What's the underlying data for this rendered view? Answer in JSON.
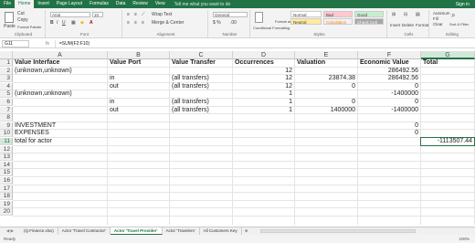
{
  "ribbon_tabs": [
    "File",
    "Home",
    "Insert",
    "Page Layout",
    "Formulas",
    "Data",
    "Review",
    "View"
  ],
  "active_tab_index": 1,
  "tell_me": "Tell me what you want to do",
  "user": "Sign in",
  "ribbon": {
    "clipboard": {
      "paste": "Paste",
      "cut": "Cut",
      "copy": "Copy",
      "format_painter": "Format Painter",
      "label": "Clipboard"
    },
    "font": {
      "name": "Arial",
      "size": "10",
      "label": "Font"
    },
    "alignment": {
      "wrap": "Wrap Text",
      "merge": "Merge & Center",
      "label": "Alignment"
    },
    "number": {
      "format": "General",
      "label": "Number"
    },
    "styles": {
      "conditional": "Conditional Formatting",
      "table": "Format as Table",
      "normal": "Normal",
      "bad": "Bad",
      "good": "Good",
      "neutral": "Neutral",
      "calculation": "Calculation",
      "check_cell": "Check Cell",
      "label": "Styles"
    },
    "cells": {
      "insert": "Insert",
      "delete": "Delete",
      "format": "Format",
      "label": "Cells"
    },
    "editing": {
      "autosum": "AutoSum",
      "fill": "Fill",
      "clear": "Clear",
      "sort": "Sort & Filter",
      "find": "Find & Select",
      "label": "Editing"
    }
  },
  "formula_bar": {
    "name_box": "G11",
    "fx": "fx",
    "value": "=SUM(F2:F10)"
  },
  "columns": [
    "A",
    "B",
    "C",
    "D",
    "E",
    "F",
    "G"
  ],
  "selected_column": "G",
  "rows": [
    {
      "n": "1",
      "A": "Value Interface",
      "B": "Value Port",
      "C": "Value Transfer",
      "D": "Occurrences",
      "E": "Valuation",
      "F": "Economic Value",
      "G": "Total"
    },
    {
      "n": "2",
      "A": "(unknown,unknown)",
      "B": "",
      "C": "",
      "D": "12",
      "E": "",
      "F": "286492.56",
      "G": ""
    },
    {
      "n": "3",
      "A": "",
      "B": "in",
      "C": "(all transfers)",
      "D": "12",
      "E": "23874.38",
      "F": "286492.56",
      "G": ""
    },
    {
      "n": "4",
      "A": "",
      "B": "out",
      "C": "(all transfers)",
      "D": "12",
      "E": "0",
      "F": "0",
      "G": ""
    },
    {
      "n": "5",
      "A": "(unknown,unknown)",
      "B": "",
      "C": "",
      "D": "1",
      "E": "",
      "F": "-1400000",
      "G": ""
    },
    {
      "n": "6",
      "A": "",
      "B": "in",
      "C": "(all transfers)",
      "D": "1",
      "E": "0",
      "F": "0",
      "G": ""
    },
    {
      "n": "7",
      "A": "",
      "B": "out",
      "C": "(all transfers)",
      "D": "1",
      "E": "1400000",
      "F": "-1400000",
      "G": ""
    },
    {
      "n": "8",
      "A": "",
      "B": "",
      "C": "",
      "D": "",
      "E": "",
      "F": "",
      "G": ""
    },
    {
      "n": "9",
      "A": "INVESTMENT",
      "B": "",
      "C": "",
      "D": "",
      "E": "",
      "F": "0",
      "G": ""
    },
    {
      "n": "10",
      "A": "EXPENSES",
      "B": "",
      "C": "",
      "D": "",
      "E": "",
      "F": "0",
      "G": ""
    },
    {
      "n": "11",
      "A": "total for actor",
      "B": "",
      "C": "",
      "D": "",
      "E": "",
      "F": "",
      "G": "-1113507.44"
    },
    {
      "n": "12",
      "A": "",
      "B": "",
      "C": "",
      "D": "",
      "E": "",
      "F": "",
      "G": ""
    },
    {
      "n": "13",
      "A": "",
      "B": "",
      "C": "",
      "D": "",
      "E": "",
      "F": "",
      "G": ""
    },
    {
      "n": "14",
      "A": "",
      "B": "",
      "C": "",
      "D": "",
      "E": "",
      "F": "",
      "G": ""
    },
    {
      "n": "15",
      "A": "",
      "B": "",
      "C": "",
      "D": "",
      "E": "",
      "F": "",
      "G": ""
    },
    {
      "n": "16",
      "A": "",
      "B": "",
      "C": "",
      "D": "",
      "E": "",
      "F": "",
      "G": ""
    },
    {
      "n": "17",
      "A": "",
      "B": "",
      "C": "",
      "D": "",
      "E": "",
      "F": "",
      "G": ""
    },
    {
      "n": "18",
      "A": "",
      "B": "",
      "C": "",
      "D": "",
      "E": "",
      "F": "",
      "G": ""
    },
    {
      "n": "19",
      "A": "",
      "B": "",
      "C": "",
      "D": "",
      "E": "",
      "F": "",
      "G": ""
    },
    {
      "n": "20",
      "A": "",
      "B": "",
      "C": "",
      "D": "",
      "E": "",
      "F": "",
      "G": ""
    }
  ],
  "bold_rows": [
    "1"
  ],
  "right_aligned_columns": [
    "D",
    "E",
    "F",
    "G"
  ],
  "selected_cell": {
    "row": "11",
    "col": "G"
  },
  "sheet_tabs": [
    "(Q.Finance.xlsx)",
    "Actor 'Travel Contractor'",
    "Actor 'Travel Provider'",
    "Actor 'Travelers'",
    "All Customers Key"
  ],
  "active_sheet_index": 2,
  "status": {
    "ready": "Ready",
    "zoom": "100%"
  },
  "colors": {
    "accent": "#217346",
    "bad_fill": "#ffc7ce",
    "good_fill": "#c6efce",
    "neutral_fill": "#ffeb9c",
    "calc_fill": "#f2f2f2",
    "check_fill": "#a5a5a5"
  }
}
